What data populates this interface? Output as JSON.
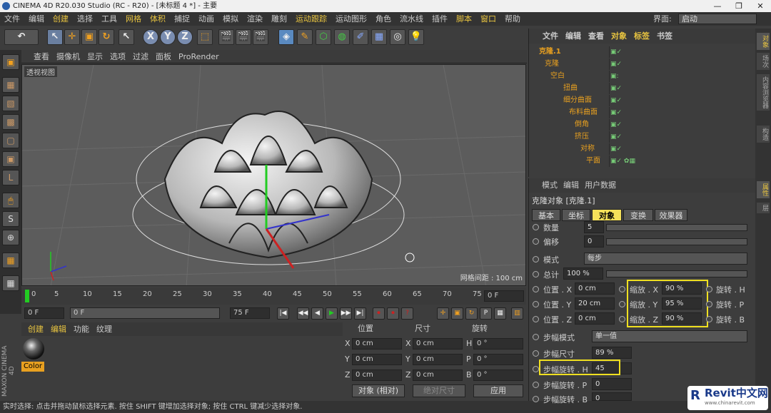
{
  "window": {
    "title": "CINEMA 4D R20.030 Studio (RC - R20) - [未标题 4 *] - 主要",
    "controls": [
      "—",
      "❐",
      "✕"
    ]
  },
  "menubar": {
    "items": [
      "文件",
      "编辑",
      "创建",
      "选择",
      "工具",
      "网格",
      "体积",
      "捕捉",
      "动画",
      "模拟",
      "渲染",
      "雕刻",
      "运动跟踪",
      "运动图形",
      "角色",
      "流水线",
      "插件",
      "脚本",
      "窗口",
      "帮助"
    ],
    "highlighted": [
      "创建",
      "网格",
      "体积",
      "运动跟踪",
      "脚本",
      "窗口"
    ],
    "layout_label": "界面:",
    "layout_value": "启动"
  },
  "toolbar": {
    "undo": "↶",
    "buttons": [
      "↖",
      "✛",
      "▣",
      "↻",
      "↖",
      "X",
      "Y",
      "Z",
      "⬚",
      "🎬",
      "🎬",
      "🎬",
      "◈",
      "✎",
      "⬡",
      "◍",
      "✐",
      "▦",
      "◎",
      "⊛",
      "💡"
    ]
  },
  "left_tools": [
    "▣",
    "▦",
    "▧",
    "▩",
    "▢",
    "▣",
    "L",
    "🖱",
    "S",
    "⊕",
    "▦",
    "▦"
  ],
  "viewport": {
    "menu": [
      "查看",
      "摄像机",
      "显示",
      "选项",
      "过滤",
      "面板",
      "ProRender"
    ],
    "title": "透视视图",
    "grid_spacing": "网格间距 : 100 cm"
  },
  "timeline": {
    "ticks": [
      "0",
      "5",
      "10",
      "15",
      "20",
      "25",
      "30",
      "35",
      "40",
      "45",
      "50",
      "55",
      "60",
      "65",
      "70",
      "75"
    ],
    "current_frame": "0 F"
  },
  "time_controls": {
    "start": "0 F",
    "range_start": "0 F",
    "range_end": "75 F",
    "end": "75 F",
    "buttons": [
      "|◀",
      "◀◀",
      "◀",
      "▶",
      "▶▶",
      "▶|",
      "⏺",
      "⏺",
      "?",
      "✛",
      "▣",
      "↻",
      "P",
      "▦",
      "▥"
    ]
  },
  "material_panel": {
    "menu": [
      "创建",
      "编辑",
      "功能",
      "纹理"
    ],
    "material_name": "Color"
  },
  "coord_panel": {
    "headers": [
      "位置",
      "尺寸",
      "旋转"
    ],
    "rows": [
      {
        "axis": "X",
        "pos": "0 cm",
        "size_axis": "X",
        "size": "0 cm",
        "rot_axis": "H",
        "rot": "0 °"
      },
      {
        "axis": "Y",
        "pos": "0 cm",
        "size_axis": "Y",
        "size": "0 cm",
        "rot_axis": "P",
        "rot": "0 °"
      },
      {
        "axis": "Z",
        "pos": "0 cm",
        "size_axis": "Z",
        "size": "0 cm",
        "rot_axis": "B",
        "rot": "0 °"
      }
    ],
    "mode": "对象 (相对)",
    "size_mode": "绝对尺寸",
    "apply": "应用"
  },
  "status": "实时选择: 点击并拖动鼠标选择元素. 按住 SHIFT 键增加选择对象; 按住 CTRL 键减少选择对象.",
  "object_panel": {
    "menu": [
      "文件",
      "编辑",
      "查看",
      "对象",
      "标签",
      "书签"
    ],
    "objects": [
      {
        "name": "克隆.1",
        "indent": 0
      },
      {
        "name": "克隆",
        "indent": 1
      },
      {
        "name": "空白",
        "indent": 2
      },
      {
        "name": "扭曲",
        "indent": 3
      },
      {
        "name": "细分曲面",
        "indent": 3
      },
      {
        "name": "布料曲面",
        "indent": 4
      },
      {
        "name": "倒角",
        "indent": 5
      },
      {
        "name": "挤压",
        "indent": 5
      },
      {
        "name": "对称",
        "indent": 6
      },
      {
        "name": "平面",
        "indent": 7
      }
    ]
  },
  "attr_panel": {
    "menu": [
      "模式",
      "编辑",
      "用户数据"
    ],
    "title": "克隆对象 [克隆.1]",
    "tabs": [
      "基本",
      "坐标",
      "对象",
      "变换",
      "效果器"
    ],
    "active_tab": "对象",
    "fields": {
      "count_label": "数量",
      "count": "5",
      "offset_label": "偏移",
      "offset": "0",
      "mode_label": "模式",
      "mode": "每步",
      "total_label": "总计",
      "total": "100 %",
      "pos_x_label": "位置 . X",
      "pos_x": "0 cm",
      "pos_y_label": "位置 . Y",
      "pos_y": "20 cm",
      "pos_z_label": "位置 . Z",
      "pos_z": "0 cm",
      "scale_x_label": "缩放 . X",
      "scale_x": "90 %",
      "scale_y_label": "缩放 . Y",
      "scale_y": "95 %",
      "scale_z_label": "缩放 . Z",
      "scale_z": "90 %",
      "rot_h_label": "旋转 . H",
      "rot_p_label": "旋转 . P",
      "rot_b_label": "旋转 . B",
      "step_mode_label": "步幅模式",
      "step_mode": "单一值",
      "step_size_label": "步幅尺寸",
      "step_size": "89 %",
      "step_rot_h_label": "步幅旋转 . H",
      "step_rot_h": "45",
      "step_rot_p_label": "步幅旋转 . P",
      "step_rot_p": "0",
      "step_rot_b_label": "步幅旋转 . B",
      "step_rot_b": "0"
    }
  },
  "side_tabs": [
    "对象",
    "场次",
    "内容浏览器",
    "构造"
  ],
  "side_tabs2": [
    "属性",
    "层"
  ],
  "watermark": {
    "text": "Revit中文网",
    "url": "www.chinarevit.com"
  }
}
